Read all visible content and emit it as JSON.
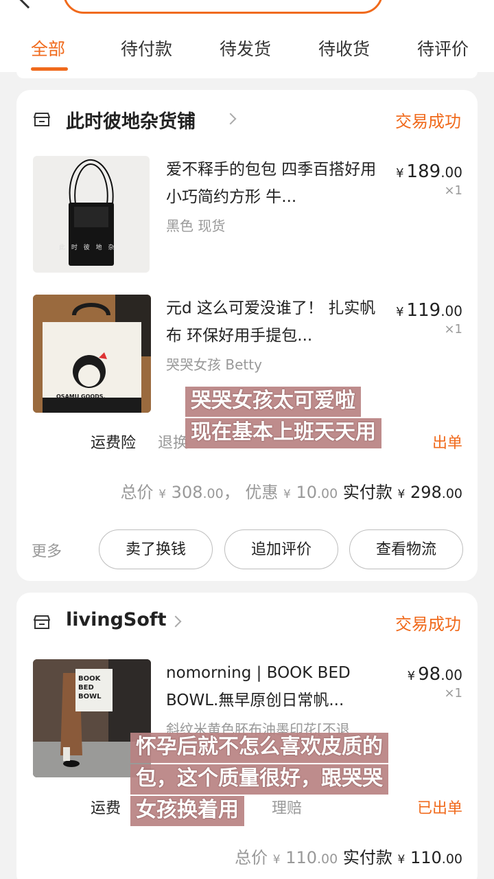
{
  "tabs": [
    "全部",
    "待付款",
    "待发货",
    "待收货",
    "待评价"
  ],
  "orders": [
    {
      "shop": "此时彼地杂货铺",
      "status": "交易成功",
      "items": [
        {
          "title": "爱不释手的包包 四季百搭好用 小巧简约方形 牛...",
          "spec": "黑色 现货",
          "price_int": "189",
          "price_dec": ".00",
          "currency": "¥",
          "qty": "×1",
          "thumb_watermark": "此 时 彼 地 杂"
        },
        {
          "title": "元d 这么可爱没谁了！ 扎实帆布 环保好用手提包...",
          "spec": "哭哭女孩 Betty",
          "price_int": "119",
          "price_dec": ".00",
          "currency": "¥",
          "qty": "×1",
          "thumb_text": "OSAMU GOODS."
        }
      ],
      "services": [
        "运费险",
        "退换",
        "出单"
      ],
      "totals": {
        "total_label": "总价",
        "total_int": "308",
        "total_dec": ".00",
        "comma": "，",
        "discount_label": "优惠",
        "discount_int": "10",
        "discount_dec": ".00",
        "paid_label": "实付款",
        "paid_int": "298",
        "paid_dec": ".00",
        "currency": "¥"
      },
      "more": "更多",
      "buttons": [
        "卖了换钱",
        "追加评价",
        "查看物流"
      ],
      "overlay": [
        "哭哭女孩太可爱啦",
        "现在基本上班天天用"
      ]
    },
    {
      "shop": "livingSoft",
      "status": "交易成功",
      "items": [
        {
          "title": "nomorning | BOOK BED BOWL.無早原创日常帆...",
          "spec": "斜纹米黄色胚布油墨印花[不退",
          "price_int": "98",
          "price_dec": ".00",
          "currency": "¥",
          "qty": "×1",
          "thumb_text": "BOOK BED BOWL"
        }
      ],
      "services": [
        "运费",
        "理赔",
        "已出单"
      ],
      "totals": {
        "total_label": "总价",
        "total_int": "110",
        "total_dec": ".00",
        "paid_label": "实付款",
        "paid_int": "110",
        "paid_dec": ".00",
        "currency": "¥"
      },
      "overlay": [
        "怀孕后就不怎么喜欢皮质的",
        "包，这个质量很好，跟哭哭",
        "女孩换着用"
      ]
    }
  ],
  "colors": {
    "accent": "#f06a1c",
    "overlay": "#b88282"
  }
}
